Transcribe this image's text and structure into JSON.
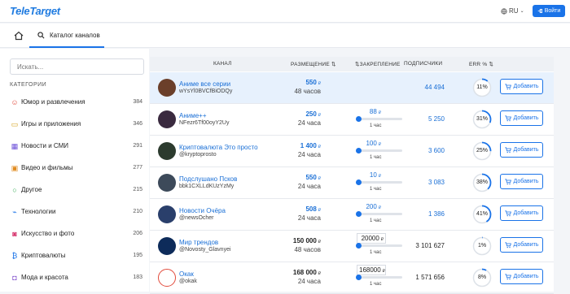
{
  "header": {
    "logo_part1": "Tele",
    "logo_part2": "Target",
    "lang": "RU",
    "login_label": "Войти"
  },
  "nav": {
    "catalog_tab": "Каталог каналов"
  },
  "sidebar": {
    "search_placeholder": "Искать...",
    "categories_heading": "КАТЕГОРИИ",
    "categories": [
      {
        "label": "Юмор и развлечения",
        "count": "384",
        "icon": "smile-icon",
        "color": "#e24a3b"
      },
      {
        "label": "Игры и приложения",
        "count": "346",
        "icon": "gamepad-icon",
        "color": "#d4a017"
      },
      {
        "label": "Новости и СМИ",
        "count": "291",
        "icon": "news-icon",
        "color": "#6b4fd8"
      },
      {
        "label": "Видео и фильмы",
        "count": "277",
        "icon": "film-icon",
        "color": "#e08a1e"
      },
      {
        "label": "Другое",
        "count": "215",
        "icon": "circle-icon",
        "color": "#2fa84f"
      },
      {
        "label": "Технологии",
        "count": "210",
        "icon": "antenna-icon",
        "color": "#1a73e8"
      },
      {
        "label": "Искусство и фото",
        "count": "206",
        "icon": "camera-icon",
        "color": "#d6336c"
      },
      {
        "label": "Криптовалюты",
        "count": "195",
        "icon": "bitcoin-icon",
        "color": "#1a73e8"
      },
      {
        "label": "Мода и красота",
        "count": "183",
        "icon": "bag-icon",
        "color": "#8a5cd0"
      }
    ]
  },
  "table": {
    "headers": {
      "channel": "КАНАЛ",
      "placement": "РАЗМЕЩЕНИЕ",
      "pin": "ЗАКРЕПЛЕНИЕ",
      "subscribers": "ПОДПИСЧИКИ",
      "err": "ERR %"
    },
    "add_label": "Добавить",
    "currency": "₽",
    "rows": [
      {
        "name": "Аниме все серии",
        "handle": "wYsYl0BVCfBiODQy",
        "price": "550",
        "period": "48 часов",
        "pin": "",
        "pin_period": "",
        "subscribers": "44 494",
        "err": "11%",
        "err_fraction": 0.11,
        "highlight": true
      },
      {
        "name": "Аниме++",
        "handle": "NFezr6Tf00oyY2Uy",
        "price": "250",
        "period": "24 часа",
        "pin": "88",
        "pin_period": "1 час",
        "subscribers": "5 250",
        "err": "31%",
        "err_fraction": 0.31,
        "highlight": false
      },
      {
        "name": "Криптовалюта Это просто",
        "handle": "@kryptoprosto",
        "price": "1 400",
        "period": "24 часа",
        "pin": "100",
        "pin_period": "1 час",
        "subscribers": "3 600",
        "err": "25%",
        "err_fraction": 0.25,
        "highlight": false
      },
      {
        "name": "Подслушано Псков",
        "handle": "bbk1CXLLdKUzYzMy",
        "price": "550",
        "period": "24 часа",
        "pin": "10",
        "pin_period": "1 час",
        "subscribers": "3 083",
        "err": "38%",
        "err_fraction": 0.38,
        "highlight": false
      },
      {
        "name": "Новости Очёра",
        "handle": "@newsOcher",
        "price": "508",
        "period": "24 часа",
        "pin": "200",
        "pin_period": "1 час",
        "subscribers": "1 386",
        "err": "41%",
        "err_fraction": 0.41,
        "highlight": false
      },
      {
        "name": "Мир трендов",
        "handle": "@Novosty_Glavnyei",
        "price": "150 000",
        "period": "48 часов",
        "pin": "20000",
        "pin_period": "1 час",
        "subscribers": "3 101 627",
        "err": "1%",
        "err_fraction": 0.01,
        "highlight": false
      },
      {
        "name": "Окак",
        "handle": "@okak",
        "price": "168 000",
        "period": "24 часа",
        "pin": "168000",
        "pin_period": "1 час",
        "subscribers": "1 571 656",
        "err": "8%",
        "err_fraction": 0.08,
        "highlight": false
      }
    ]
  }
}
